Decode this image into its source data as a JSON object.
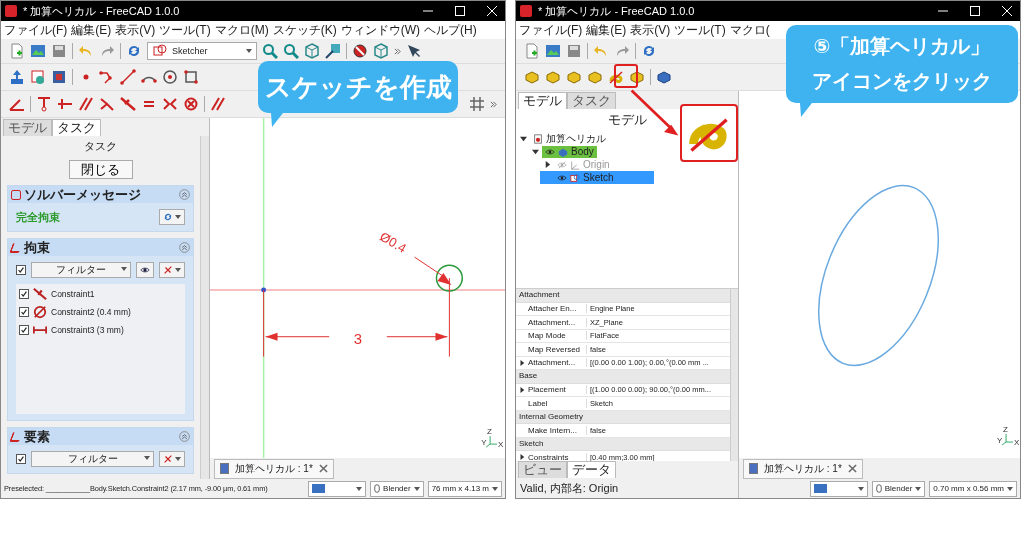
{
  "left_window": {
    "title": "* 加算ヘリカル - FreeCAD 1.0.0",
    "menu": [
      "ファイル(F)",
      "編集(E)",
      "表示(V)",
      "ツール(T)",
      "マクロ(M)",
      "スケッチ(K)",
      "ウィンドウ(W)",
      "ヘルプ(H)"
    ],
    "workbench": "Sketcher",
    "panel_tabs": [
      {
        "label": "モデル",
        "selected": false
      },
      {
        "label": "タスク",
        "selected": true
      }
    ],
    "task_title": "タスク",
    "close_button": "閉じる",
    "solver": {
      "title": "ソルバーメッセージ",
      "status": "完全拘束"
    },
    "constraints": {
      "title": "拘束",
      "filter_checked": true,
      "filter": "フィルター",
      "items": [
        {
          "label": "Constraint1",
          "checked": true,
          "kind": "tangent"
        },
        {
          "label": "Constraint2 (0.4 mm)",
          "checked": true,
          "kind": "diameter"
        },
        {
          "label": "Constraint3 (3 mm)",
          "checked": true,
          "kind": "distance"
        }
      ]
    },
    "elements": {
      "title": "要素",
      "filter_checked": true,
      "filter": "フィルター"
    },
    "sketch": {
      "diameter_label": "Ø0.4",
      "distance_label": "3"
    },
    "triad": [
      "Z",
      "Y",
      "X"
    ],
    "doc_tab": "加算ヘリカル : 1*",
    "status": "Preselected: ___________Body.Sketch.Constraint2 (2.17 mm, -9.00 µm, 0.61 mm)",
    "nav_style": "Blender",
    "view_size": "76 mm x 4.13 m",
    "callout": {
      "lines": [
        "スケッチを作成"
      ]
    }
  },
  "right_window": {
    "title": "* 加算ヘリカル - FreeCAD 1.0.0",
    "menu": [
      "ファイル(F)",
      "編集(E)",
      "表示(V)",
      "ツール(T)",
      "マクロ("
    ],
    "panel_tabs": [
      {
        "label": "モデル",
        "selected": true
      },
      {
        "label": "タスク",
        "selected": false
      }
    ],
    "tree_title": "モデル",
    "tree": [
      {
        "label": "加算ヘリカル",
        "kind": "document",
        "expanded": true,
        "selected": false,
        "active": false,
        "children": [
          {
            "label": "Body",
            "kind": "body",
            "expanded": true,
            "selected": false,
            "active": true,
            "visible": true,
            "children": [
              {
                "label": "Origin",
                "kind": "origin",
                "expanded": false,
                "selected": false,
                "active": false,
                "visible": false
              },
              {
                "label": "Sketch",
                "kind": "sketch",
                "selected": true,
                "active": false,
                "visible": true
              }
            ]
          }
        ]
      }
    ],
    "properties": [
      {
        "group": "Attachment",
        "rows": [
          {
            "name": "Attacher En...",
            "value": "Engine Plane",
            "expandable": false
          },
          {
            "name": "Attachment...",
            "value": "XZ_Plane",
            "expandable": false
          },
          {
            "name": "Map Mode",
            "value": "FlatFace",
            "expandable": false
          },
          {
            "name": "Map Reversed",
            "value": "false",
            "expandable": false
          },
          {
            "name": "Attachment...",
            "value": "[(0.00 0.00 1.00); 0.00,°(0.00 mm ...",
            "expandable": true
          }
        ]
      },
      {
        "group": "Base",
        "rows": [
          {
            "name": "Placement",
            "value": "[(1.00 0.00 0.00); 90.00,°(0.00 mm...",
            "expandable": true
          },
          {
            "name": "Label",
            "value": "Sketch",
            "expandable": false
          }
        ]
      },
      {
        "group": "Internal Geometry",
        "rows": [
          {
            "name": "Make Intern...",
            "value": "false",
            "expandable": false
          }
        ]
      },
      {
        "group": "Sketch",
        "rows": [
          {
            "name": "Constraints",
            "value": "[0.40 mm;3.00 mm]",
            "expandable": true
          }
        ]
      }
    ],
    "property_tabs": [
      {
        "label": "ビュー",
        "selected": false
      },
      {
        "label": "データ",
        "selected": true
      }
    ],
    "status": "Valid, 内部名: Origin",
    "triad": [
      "Z",
      "Y",
      "X"
    ],
    "doc_tab": "加算ヘリカル : 1*",
    "nav_style": "Blender",
    "view_size": "0.70 mm x 0.56 mm",
    "callout": {
      "lines": [
        "⑤「加算ヘリカル」",
        "アイコンをクリック"
      ]
    }
  }
}
